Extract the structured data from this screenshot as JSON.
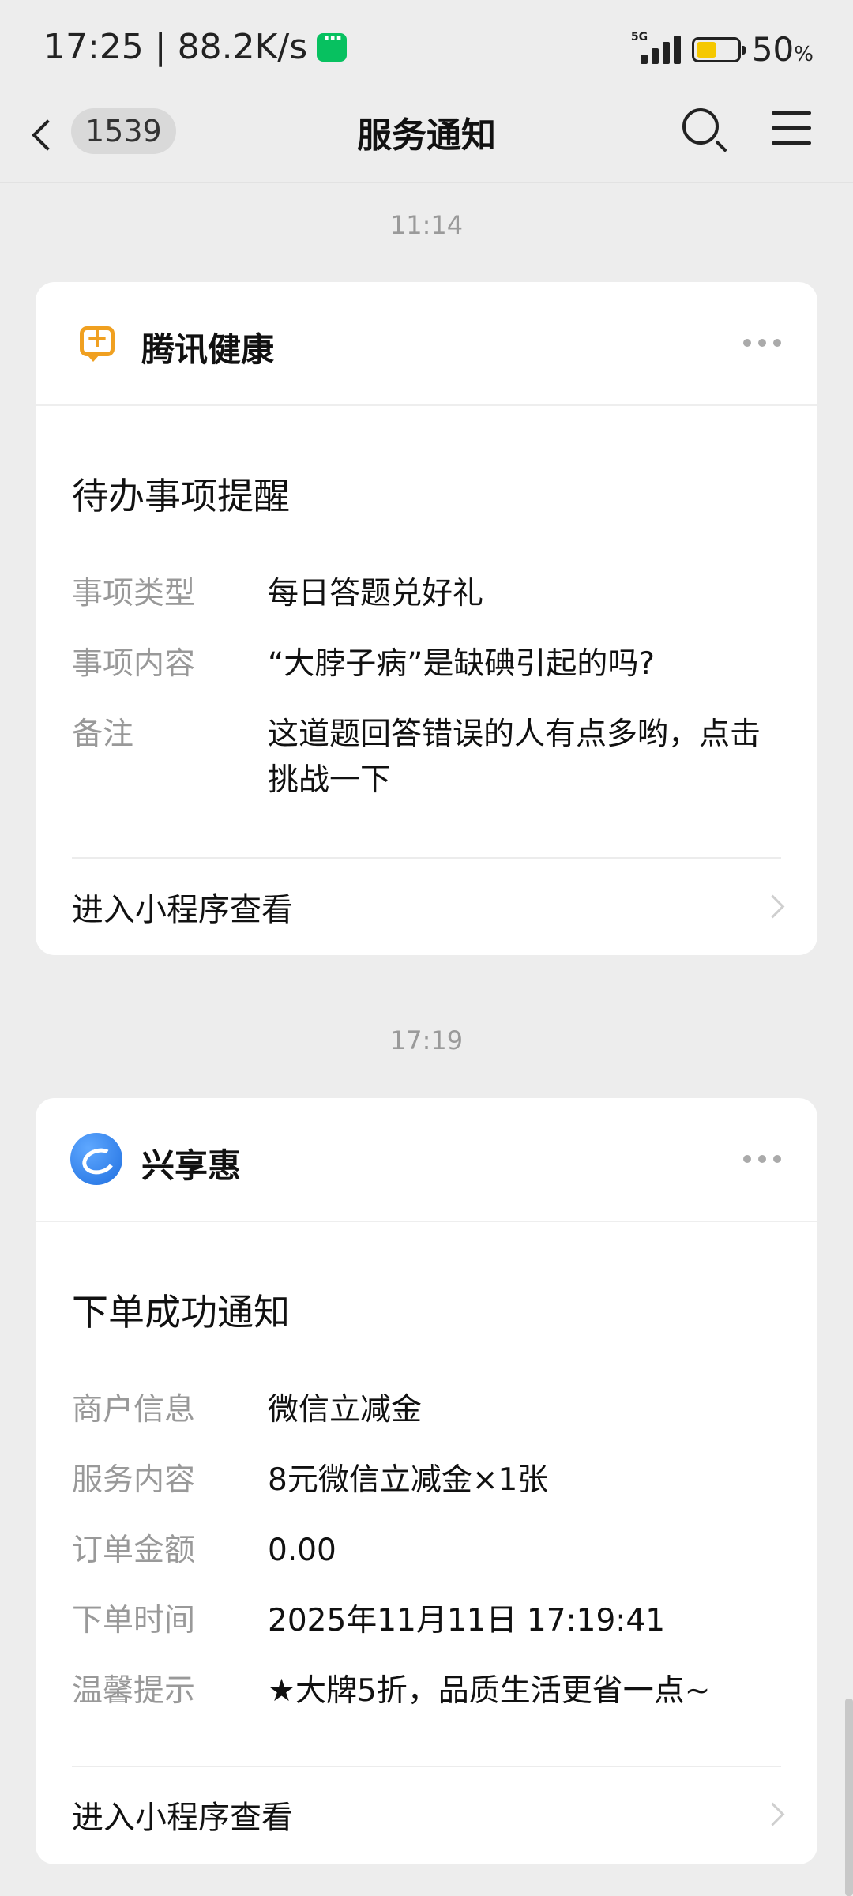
{
  "status_bar": {
    "time_speed": "17:25 | 88.2K/s",
    "network": "5G",
    "battery_level": 0.5,
    "battery_percent": "50",
    "battery_unit": "%"
  },
  "nav": {
    "badge": "1539",
    "title": "服务通知"
  },
  "messages": [
    {
      "time": "11:14",
      "service": "腾讯健康",
      "title": "待办事项提醒",
      "fields": [
        {
          "label": "事项类型",
          "value": "每日答题兑好礼"
        },
        {
          "label": "事项内容",
          "value": "“大脖子病”是缺碘引起的吗?"
        },
        {
          "label": "备注",
          "value": "这道题回答错误的人有点多哟，点击挑战一下"
        }
      ],
      "action": "进入小程序查看"
    },
    {
      "time": "17:19",
      "service": "兴享惠",
      "title": "下单成功通知",
      "fields": [
        {
          "label": "商户信息",
          "value": "微信立减金"
        },
        {
          "label": "服务内容",
          "value": "8元微信立减金×1张"
        },
        {
          "label": "订单金额",
          "value": "0.00"
        },
        {
          "label": "下单时间",
          "value": "2025年11月11日 17:19:41"
        },
        {
          "label": "温馨提示",
          "value": "★大牌5折，品质生活更省一点~"
        }
      ],
      "action": "进入小程序查看"
    }
  ],
  "colors": {
    "background": "#ededed",
    "card": "#ffffff",
    "accent_green": "#07c160",
    "health_orange": "#f0a020",
    "xxh_blue": "#1f6fe0"
  }
}
